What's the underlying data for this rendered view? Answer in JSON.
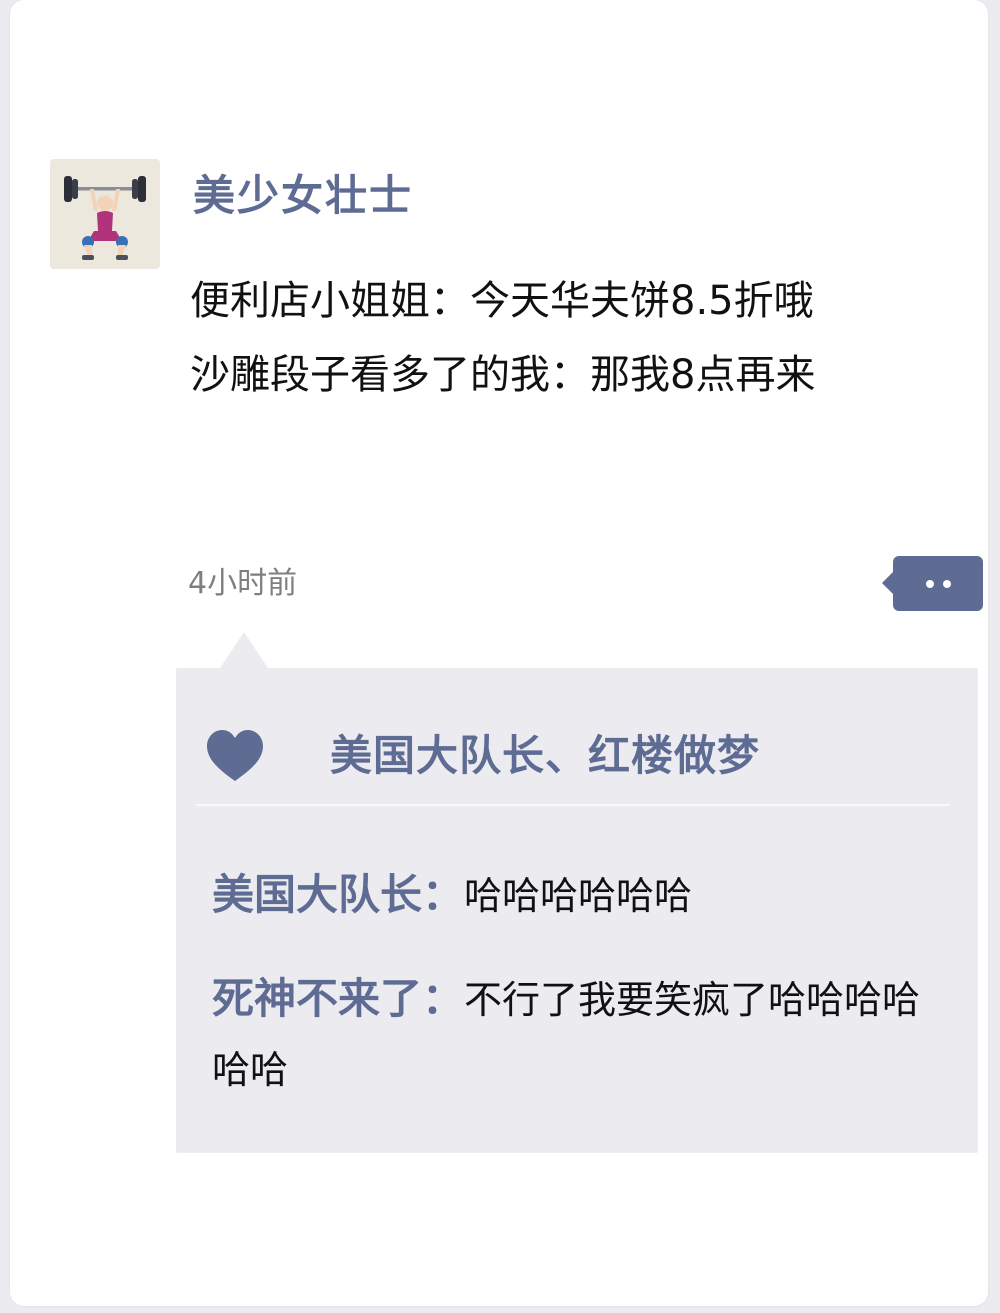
{
  "post": {
    "author_name": "美少女壮士",
    "avatar_icon": "weightlifting-woman-icon",
    "text_lines": [
      "便利店小姐姐：今天华夫饼8.5折哦",
      "沙雕段子看多了的我：那我8点再来"
    ],
    "timestamp": "4小时前",
    "more_icon": "ellipsis-icon"
  },
  "likes": {
    "icon": "heart-icon",
    "names": "美国大队长、红楼做梦"
  },
  "comments": [
    {
      "author": "美国大队长：",
      "text": "哈哈哈哈哈哈"
    },
    {
      "author": "死神不来了：",
      "text": "不行了我要笑疯了哈哈哈哈哈哈"
    }
  ],
  "colors": {
    "accent": "#5e6b93",
    "panel": "#ececf0",
    "text": "#111111",
    "muted": "#7f7f7f"
  }
}
